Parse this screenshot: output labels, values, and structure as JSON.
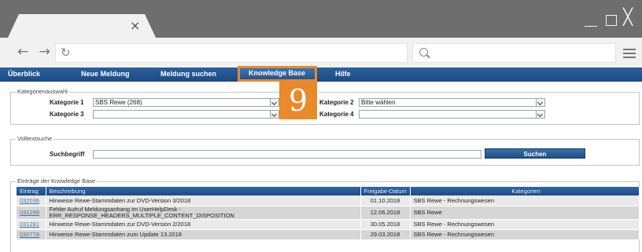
{
  "browser": {
    "tab_close_glyph": "×",
    "back_forward": "← →",
    "reload_glyph": "↻",
    "window_close_glyph": "╳"
  },
  "nav": {
    "items": [
      {
        "label": "Überblick"
      },
      {
        "label": "Neue Meldung"
      },
      {
        "label": "Meldung suchen"
      },
      {
        "label": "Knowledge Base"
      },
      {
        "label": "Hilfe"
      }
    ],
    "active": "Knowledge Base"
  },
  "step_badge": "9",
  "categories": {
    "legend": "Kategorienauswahl",
    "kategorie1_label": "Kategorie 1",
    "kategorie1_value": "SBS Rewe (268)",
    "kategorie2_label": "Kategorie 2",
    "kategorie2_value": "Bitte wählen",
    "kategorie3_label": "Kategorie 3",
    "kategorie3_value": "",
    "kategorie4_label": "Kategorie 4",
    "kategorie4_value": ""
  },
  "fulltext": {
    "legend": "Volltextsuche",
    "search_label": "Suchbegriff",
    "search_value": "",
    "search_button": "Suchen"
  },
  "entries": {
    "legend": "Einträge der Knowledge Base",
    "columns": [
      "Eintrag",
      "Beschreibung",
      "Freigabe-Datum",
      "Kategorien"
    ],
    "rows": [
      {
        "id": "032036",
        "description": "Hinweise Rewe-Stammdaten zur DVD-Version 3/2018",
        "date": "01.10.2018",
        "category": "SBS Rewe - Rechnungswesen"
      },
      {
        "id": "031298",
        "description": "Fehler Aufruf Meldungsanhang im UserHelpDesk - ERR_RESPONSE_HEADERS_MULTIPLE_CONTENT_DISPOSITION",
        "date": "12.06.2018",
        "category": "SBS Rewe"
      },
      {
        "id": "031281",
        "description": "Hinweise Rewe-Stammdaten zur DVD-Version 2/2018",
        "date": "30.05.2018",
        "category": "SBS Rewe - Rechnungswesen"
      },
      {
        "id": "030778",
        "description": "Hinweise Rewe-Stammdaten zum Update 13.2018",
        "date": "29.03.2018",
        "category": "SBS Rewe - Rechnungswesen"
      }
    ]
  },
  "colors": {
    "nav_bg": "#1c4a83",
    "highlight": "#e8892a",
    "chrome_dark": "#6e6e6e",
    "chrome_light": "#f1f1f1"
  }
}
